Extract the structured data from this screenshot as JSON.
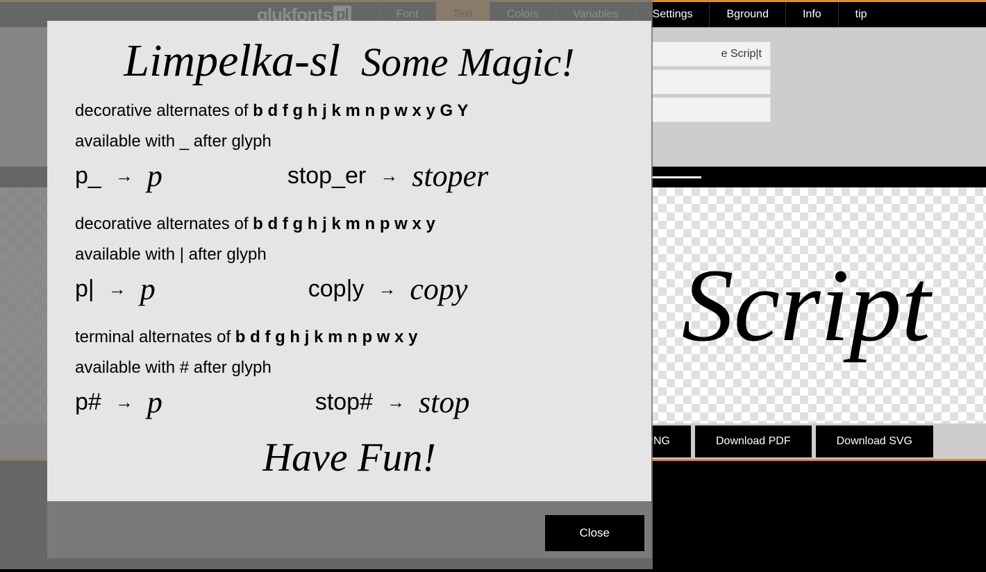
{
  "logo": {
    "text": "glukfonts",
    "suffix": "pl"
  },
  "nav": [
    {
      "label": "Font",
      "active": false
    },
    {
      "label": "Text",
      "active": true
    },
    {
      "label": "Colors",
      "active": false
    },
    {
      "label": "Variables",
      "active": false
    },
    {
      "label": "Settings",
      "active": false
    },
    {
      "label": "Bground",
      "active": false
    },
    {
      "label": "Info",
      "active": false
    },
    {
      "label": "tip",
      "active": false
    }
  ],
  "inputs": {
    "line1": "e Scrip|t"
  },
  "canvas": {
    "preview_text": "Script"
  },
  "downloads": {
    "png": "Download PNG",
    "pdf": "Download PDF",
    "svg": "Download SVG"
  },
  "modal": {
    "title_font": "Limpelka-sl",
    "title_magic": "Some Magic!",
    "section1": {
      "line1a": "decorative alternates of ",
      "line1b": "b d f g h j k m n p w x y G Y",
      "line2": "available with _ after glyph",
      "ex1_in": "p_",
      "ex1_out": "p",
      "ex2_in": "stop_er",
      "ex2_out": "stoper"
    },
    "section2": {
      "line1a": "decorative alternates of ",
      "line1b": "b d f g h j k m n p w x y",
      "line2": "available with | after glyph",
      "ex1_in": "p|",
      "ex1_out": "p",
      "ex2_in": "cop|y",
      "ex2_out": "copy"
    },
    "section3": {
      "line1a": "terminal alternates of ",
      "line1b": "b d f g h j k m n p w x y",
      "line2": "available with # after glyph",
      "ex1_in": "p#",
      "ex1_out": "p",
      "ex2_in": "stop#",
      "ex2_out": "stop"
    },
    "footer": "Have Fun!",
    "close": "Close"
  }
}
